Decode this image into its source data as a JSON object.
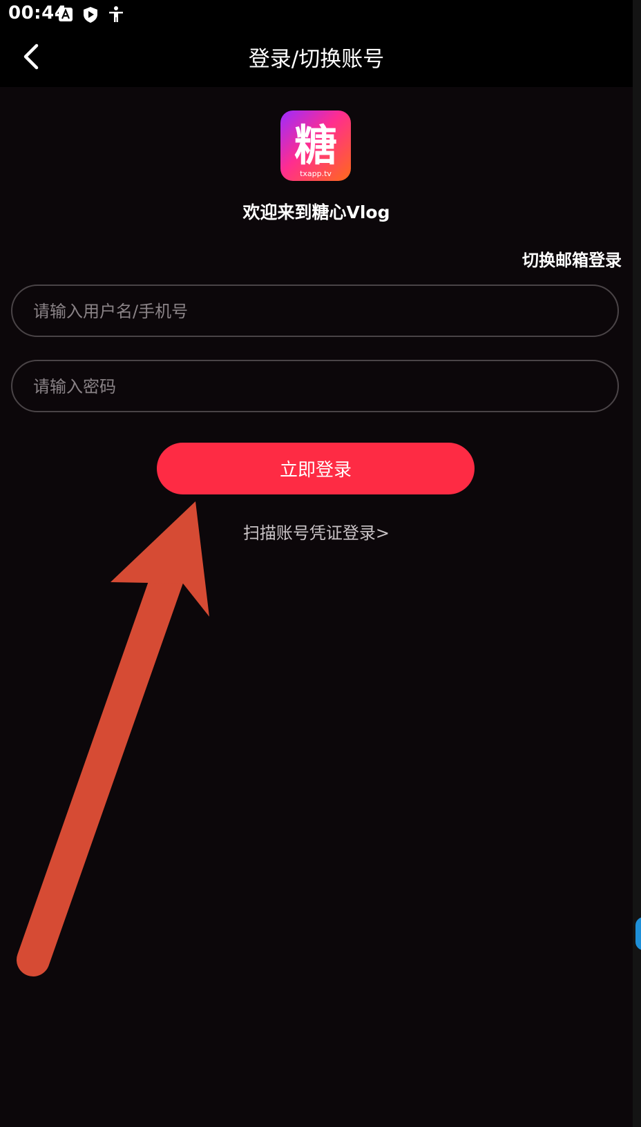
{
  "status_bar": {
    "time": "00:44",
    "icons": [
      "text-box-icon",
      "shield-play-icon",
      "accessibility-icon"
    ]
  },
  "app_bar": {
    "back_icon": "chevron-left-icon",
    "title": "登录/切换账号"
  },
  "logo": {
    "glyph": "糖",
    "caption": "txapp.tv"
  },
  "welcome_text": "欢迎来到糖心Vlog",
  "switch_login_link": "切换邮箱登录",
  "form": {
    "username_placeholder": "请输入用户名/手机号",
    "password_placeholder": "请输入密码",
    "submit_label": "立即登录"
  },
  "scan_login_link": "扫描账号凭证登录>",
  "colors": {
    "background": "#0c070a",
    "app_bar": "#000000",
    "accent": "#fe2b44",
    "annotation_arrow": "#d64b34"
  }
}
